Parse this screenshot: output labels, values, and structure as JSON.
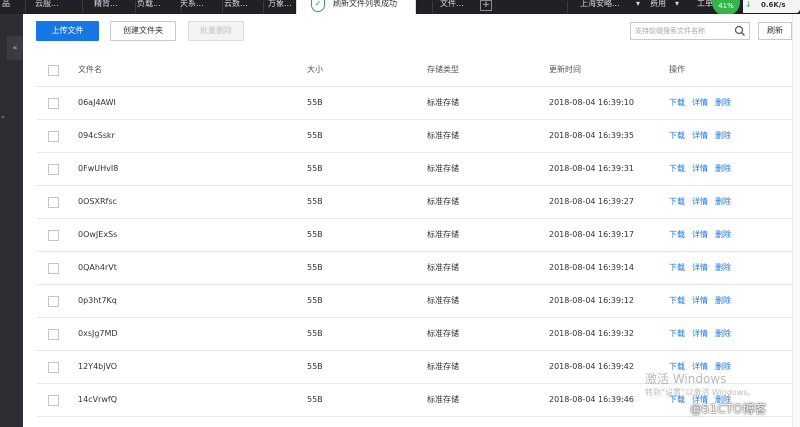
{
  "topnav": {
    "items": [
      "品",
      "云服...",
      "精背...",
      "负载...",
      "天系...",
      "云数...",
      "万象...",
      "文件...",
      "上海安略...",
      "费用",
      "工单"
    ]
  },
  "toast": {
    "message": "刷新文件列表成功"
  },
  "speed": {
    "badge": "41%",
    "rate": "0.6K/s"
  },
  "toolbar": {
    "upload_label": "上传文件",
    "create_folder_label": "创建文件夹",
    "batch_delete_label": "批量删除",
    "search_placeholder": "支持前缀搜索文件名称",
    "refresh_label": "刷新"
  },
  "table": {
    "headers": {
      "name": "文件名",
      "size": "大小",
      "type": "存储类型",
      "time": "更新时间",
      "ops": "操作"
    },
    "ops": {
      "download": "下载",
      "detail": "详情",
      "delete": "删除"
    },
    "rows": [
      {
        "name": "06aJ4AWI",
        "size": "55B",
        "type": "标准存储",
        "time": "2018-08-04 16:39:10"
      },
      {
        "name": "094cSskr",
        "size": "55B",
        "type": "标准存储",
        "time": "2018-08-04 16:39:35"
      },
      {
        "name": "0FwUHvI8",
        "size": "55B",
        "type": "标准存储",
        "time": "2018-08-04 16:39:31"
      },
      {
        "name": "0OSXRfsc",
        "size": "55B",
        "type": "标准存储",
        "time": "2018-08-04 16:39:27"
      },
      {
        "name": "0OwJExSs",
        "size": "55B",
        "type": "标准存储",
        "time": "2018-08-04 16:39:17"
      },
      {
        "name": "0QAh4rVt",
        "size": "55B",
        "type": "标准存储",
        "time": "2018-08-04 16:39:14"
      },
      {
        "name": "0p3ht7Kq",
        "size": "55B",
        "type": "标准存储",
        "time": "2018-08-04 16:39:12"
      },
      {
        "name": "0xsJg7MD",
        "size": "55B",
        "type": "标准存储",
        "time": "2018-08-04 16:39:32"
      },
      {
        "name": "12Y4bjVO",
        "size": "55B",
        "type": "标准存储",
        "time": "2018-08-04 16:39:42"
      },
      {
        "name": "14cVrwfQ",
        "size": "55B",
        "type": "标准存储",
        "time": "2018-08-04 16:39:46"
      }
    ]
  },
  "overlay": {
    "activate_title": "激活 Windows",
    "activate_sub": "转到“设置”以激活 Windows。",
    "blog_mark": "@51CTO博客"
  }
}
